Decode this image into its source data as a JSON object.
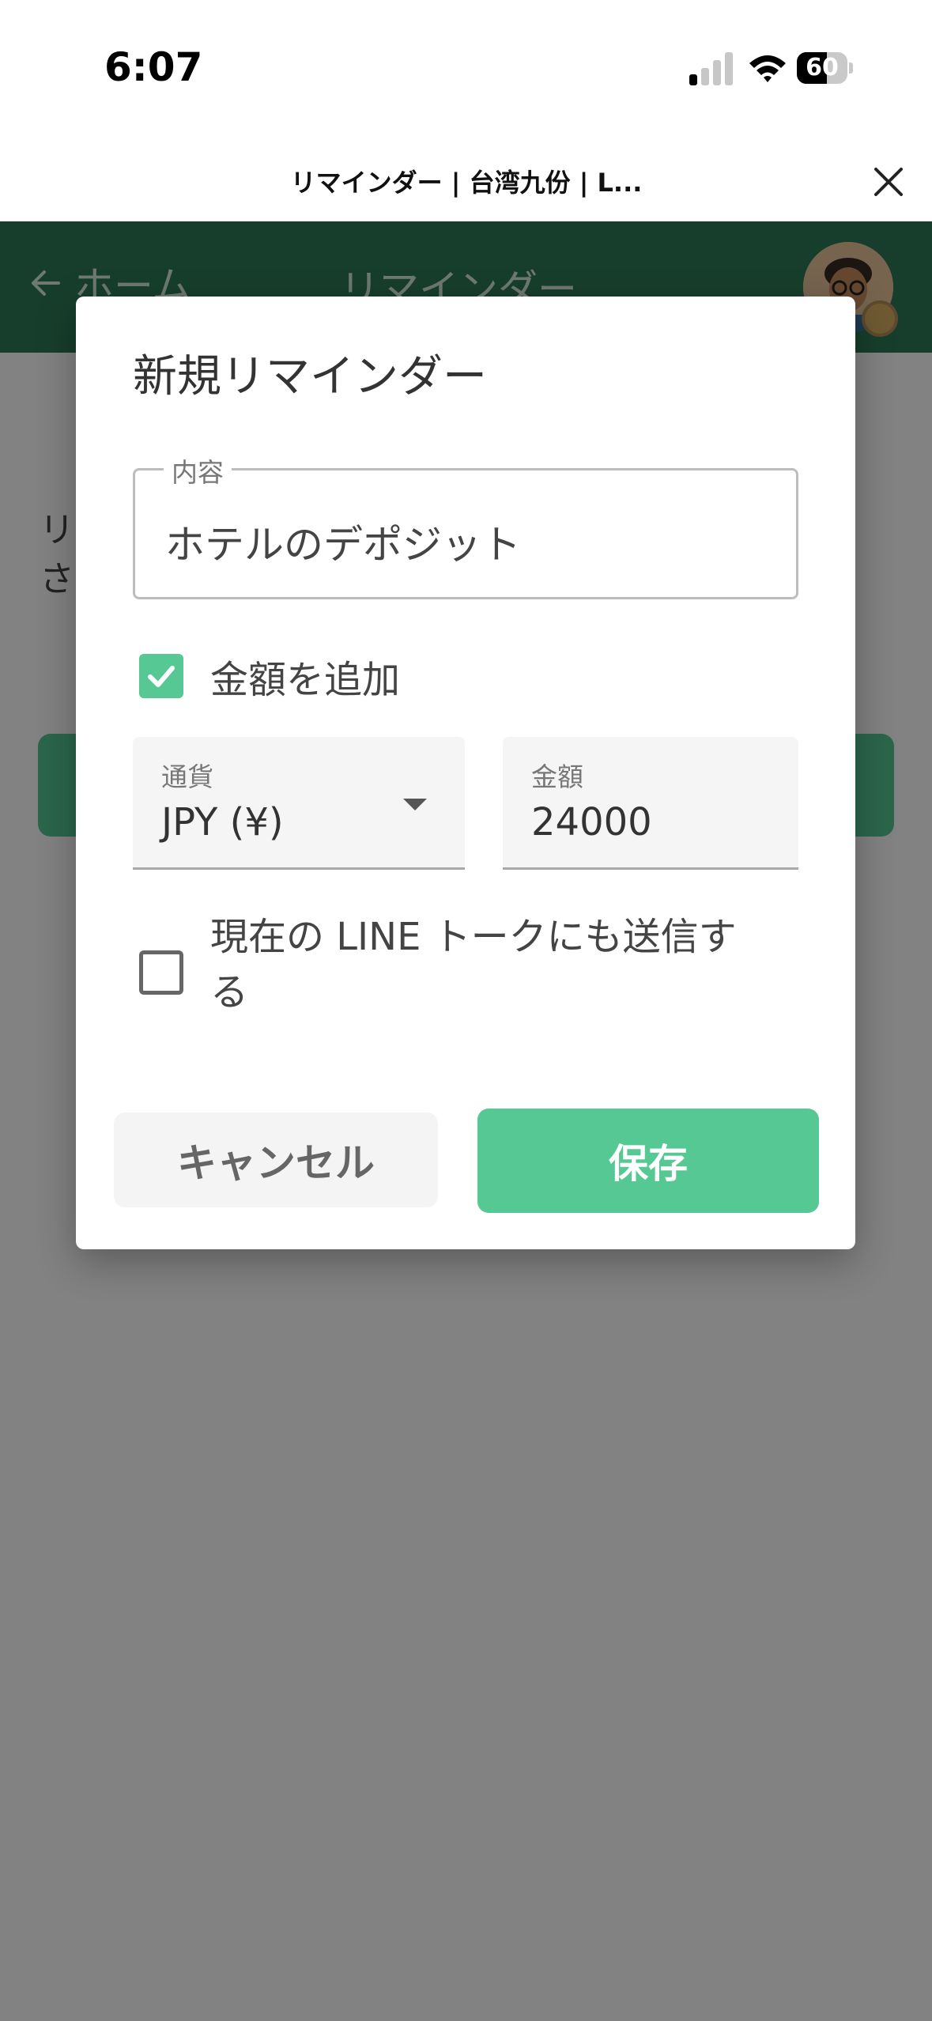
{
  "status_bar": {
    "time": "6:07",
    "battery": "60",
    "battery_level": 0.6
  },
  "browser": {
    "title": "リマインダー | 台湾九份 | L..."
  },
  "app_header": {
    "back_label": "ホーム",
    "title": "リマインダー"
  },
  "background": {
    "text_line1": "リ",
    "text_line2": "さ"
  },
  "dialog": {
    "title": "新規リマインダー",
    "content_field": {
      "label": "内容",
      "value": "ホテルのデポジット"
    },
    "add_amount": {
      "label": "金額を追加",
      "checked": true
    },
    "currency_field": {
      "label": "通貨",
      "value": "JPY (¥)"
    },
    "amount_field": {
      "label": "金額",
      "value": "24000"
    },
    "send_line": {
      "label": "現在の LINE トークにも送信する",
      "checked": false
    },
    "cancel_label": "キャンセル",
    "save_label": "保存"
  },
  "colors": {
    "accent": "#55c894",
    "header": "#2e7a57"
  }
}
